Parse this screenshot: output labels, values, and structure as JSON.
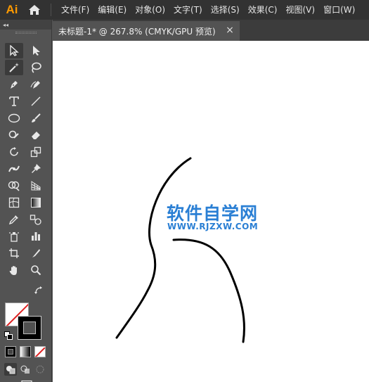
{
  "app": {
    "logo_text": "Ai",
    "brand_color": "#ff9a00",
    "menu": [
      "文件(F)",
      "编辑(E)",
      "对象(O)",
      "文字(T)",
      "选择(S)",
      "效果(C)",
      "视图(V)",
      "窗口(W)"
    ]
  },
  "toolbar": {
    "collapse_glyph": "◂◂",
    "tools": [
      "selection-tool",
      "direct-selection-tool",
      "magic-wand-tool",
      "lasso-tool",
      "pen-tool",
      "curvature-tool",
      "type-tool",
      "line-segment-tool",
      "ellipse-tool",
      "paintbrush-tool",
      "shaper-tool",
      "eraser-tool",
      "rotate-tool",
      "scale-tool",
      "puppet-warp-tool",
      "pin-tool",
      "shape-builder-tool",
      "perspective-grid-tool",
      "mesh-tool",
      "gradient-tool",
      "eyedropper-tool",
      "blend-tool",
      "symbol-sprayer-tool",
      "column-graph-tool",
      "artboard-tool",
      "slice-tool",
      "hand-tool",
      "zoom-tool"
    ],
    "active_tool": "selection-tool",
    "fill_color": "none",
    "stroke_color": "#000000"
  },
  "document": {
    "tab_title": "未标题-1* @ 267.8% (CMYK/GPU 预览)",
    "close_glyph": "×"
  },
  "canvas": {
    "watermark_title": "软件自学网",
    "watermark_url": "WWW.RJZXW.COM",
    "watermark_color": "#2a7fd4"
  }
}
